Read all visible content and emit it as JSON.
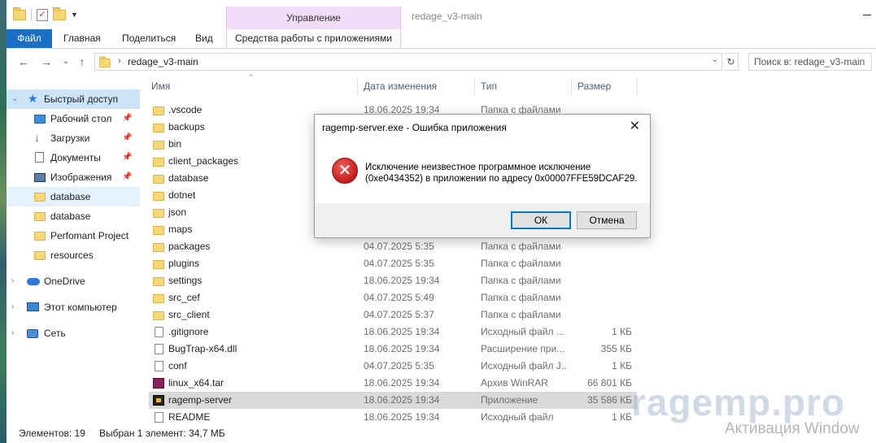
{
  "window": {
    "title": "redage_v3-main",
    "context_tab": "Управление"
  },
  "ribbon": {
    "tabs": [
      "Файл",
      "Главная",
      "Поделиться",
      "Вид"
    ],
    "context_tab_label": "Средства работы с приложениями"
  },
  "address": {
    "path": "redage_v3-main",
    "search_placeholder": "Поиск в: redage_v3-main"
  },
  "nav": {
    "quick_access": "Быстрый доступ",
    "items": [
      {
        "label": "Рабочий стол",
        "icon": "desktop-icon",
        "pinned": true
      },
      {
        "label": "Загрузки",
        "icon": "download-icon",
        "pinned": true
      },
      {
        "label": "Документы",
        "icon": "documents-icon",
        "pinned": true
      },
      {
        "label": "Изображения",
        "icon": "pictures-icon",
        "pinned": true
      },
      {
        "label": "database",
        "icon": "folder-icon",
        "pinned": false
      },
      {
        "label": "database",
        "icon": "folder-icon",
        "pinned": false
      },
      {
        "label": "Perfomant Project",
        "icon": "folder-icon",
        "pinned": false
      },
      {
        "label": "resources",
        "icon": "folder-icon",
        "pinned": false
      }
    ],
    "onedrive": "OneDrive",
    "this_pc": "Этот компьютер",
    "network": "Сеть"
  },
  "columns": {
    "name": "Имя",
    "date": "Дата изменения",
    "type": "Тип",
    "size": "Размер"
  },
  "files": [
    {
      "name": ".vscode",
      "date": "18.06.2025 19:34",
      "type": "Папка с файлами",
      "size": "",
      "icon": "folder"
    },
    {
      "name": "backups",
      "date": "",
      "type": "",
      "size": "",
      "icon": "folder"
    },
    {
      "name": "bin",
      "date": "",
      "type": "",
      "size": "",
      "icon": "folder"
    },
    {
      "name": "client_packages",
      "date": "",
      "type": "",
      "size": "",
      "icon": "folder"
    },
    {
      "name": "database",
      "date": "",
      "type": "",
      "size": "",
      "icon": "folder"
    },
    {
      "name": "dotnet",
      "date": "",
      "type": "",
      "size": "",
      "icon": "folder"
    },
    {
      "name": "json",
      "date": "",
      "type": "",
      "size": "",
      "icon": "folder"
    },
    {
      "name": "maps",
      "date": "",
      "type": "",
      "size": "",
      "icon": "folder"
    },
    {
      "name": "packages",
      "date": "04.07.2025 5:35",
      "type": "Папка с файлами",
      "size": "",
      "icon": "folder"
    },
    {
      "name": "plugins",
      "date": "04.07.2025 5:35",
      "type": "Папка с файлами",
      "size": "",
      "icon": "folder"
    },
    {
      "name": "settings",
      "date": "18.06.2025 19:34",
      "type": "Папка с файлами",
      "size": "",
      "icon": "folder"
    },
    {
      "name": "src_cef",
      "date": "04.07.2025 5:49",
      "type": "Папка с файлами",
      "size": "",
      "icon": "folder"
    },
    {
      "name": "src_client",
      "date": "04.07.2025 5:37",
      "type": "Папка с файлами",
      "size": "",
      "icon": "folder"
    },
    {
      "name": ".gitignore",
      "date": "18.06.2025 19:34",
      "type": "Исходный файл ...",
      "size": "1 КБ",
      "icon": "gear"
    },
    {
      "name": "BugTrap-x64.dll",
      "date": "18.06.2025 19:34",
      "type": "Расширение при...",
      "size": "355 КБ",
      "icon": "dll"
    },
    {
      "name": "conf",
      "date": "04.07.2025 5:35",
      "type": "Исходный файл J...",
      "size": "1 КБ",
      "icon": "file"
    },
    {
      "name": "linux_x64.tar",
      "date": "18.06.2025 19:34",
      "type": "Архив WinRAR",
      "size": "66 801 КБ",
      "icon": "tar"
    },
    {
      "name": "ragemp-server",
      "date": "18.06.2025 19:34",
      "type": "Приложение",
      "size": "35 586 КБ",
      "icon": "exe",
      "selected": true
    },
    {
      "name": "README",
      "date": "18.06.2025 19:34",
      "type": "Исходный файл",
      "size": "1 КБ",
      "icon": "file"
    }
  ],
  "status": {
    "count": "Элементов: 19",
    "selection": "Выбран 1 элемент: 34,7 МБ"
  },
  "dialog": {
    "title": "ragemp-server.exe - Ошибка приложения",
    "line1": "Исключение неизвестное программное исключение",
    "line2": "(0xe0434352) в приложении по адресу 0x00007FFE59DCAF29.",
    "ok": "ОК",
    "cancel": "Отмена",
    "close_glyph": "✕",
    "error_glyph": "✕"
  },
  "watermarks": {
    "brand": "ragemp.pro",
    "activation": "Активация Window"
  },
  "icons": {
    "back": "←",
    "forward": "→",
    "recent": "⌄",
    "up": "↑",
    "chevron_right": "›",
    "chevron_down": "⌄",
    "refresh": "↻",
    "pin": "📌",
    "expand": "›",
    "expand_open": "⌄",
    "sort_up": "⌃"
  },
  "colors": {
    "file_tab": "#1a6fc4",
    "context_tab": "#f3dcf7",
    "selection": "#cce4f7",
    "error_red": "#c41b1b"
  }
}
